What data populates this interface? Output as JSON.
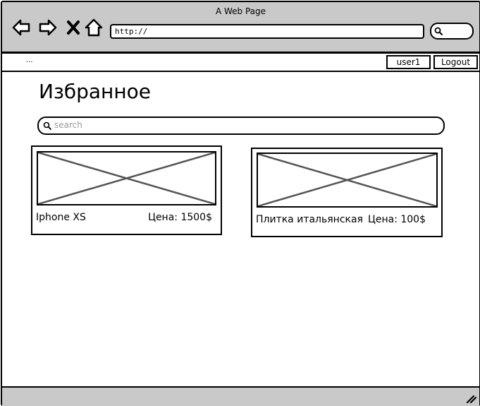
{
  "window": {
    "title": "A Web Page"
  },
  "browser": {
    "url": "http://",
    "icons": [
      "back-arrow-icon",
      "forward-arrow-icon",
      "close-x-icon",
      "home-icon",
      "search-icon"
    ]
  },
  "menubar": {
    "placeholder_text": "...",
    "user_label": "user1",
    "logout_label": "Logout"
  },
  "page": {
    "title": "Избранное",
    "search_placeholder": "search"
  },
  "favorites": [
    {
      "name": "Iphone XS",
      "price": "Цена: 1500$"
    },
    {
      "name": "Плитка итальянская",
      "price": "Цена: 100$"
    }
  ],
  "colors": {
    "chrome": "#c9c9c9",
    "stroke": "#000000",
    "placeholder_cross": "#555555"
  }
}
